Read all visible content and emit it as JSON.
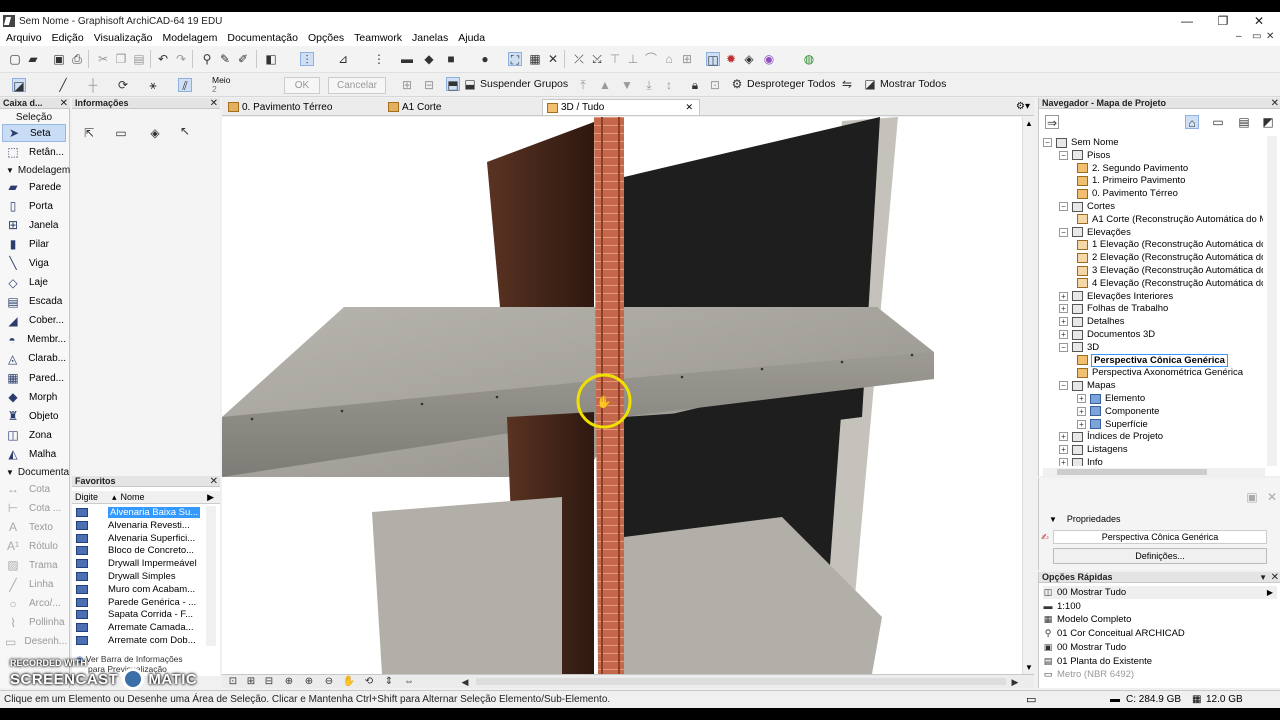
{
  "window": {
    "title": "Sem Nome - Graphisoft ArchiCAD-64 19 EDU",
    "min": "—",
    "max": "❐",
    "close": "✕"
  },
  "menu": [
    "Arquivo",
    "Edição",
    "Visualização",
    "Modelagem",
    "Documentação",
    "Opções",
    "Teamwork",
    "Janelas",
    "Ajuda"
  ],
  "toolbar2": {
    "meio_label": "Meio",
    "meio_value": "2",
    "ok": "OK",
    "cancel": "Cancelar",
    "suspend_groups": "Suspender Grupos",
    "unprotect_all": "Desproteger Todos",
    "show_all": "Mostrar Todos"
  },
  "toolbox": {
    "title": "Caixa d...",
    "groups": {
      "selection": "Seleção",
      "modeling": "Modelagem",
      "document": "Documenta"
    },
    "selection_tools": [
      {
        "label": "Seta",
        "icon": "arrow-icon"
      },
      {
        "label": "Retân...",
        "icon": "marquee-icon"
      }
    ],
    "modeling_tools": [
      {
        "label": "Parede",
        "icon": "wall-icon"
      },
      {
        "label": "Porta",
        "icon": "door-icon"
      },
      {
        "label": "Janela",
        "icon": "window-icon"
      },
      {
        "label": "Pilar",
        "icon": "column-icon"
      },
      {
        "label": "Viga",
        "icon": "beam-icon"
      },
      {
        "label": "Laje",
        "icon": "slab-icon"
      },
      {
        "label": "Escada",
        "icon": "stair-icon"
      },
      {
        "label": "Cober...",
        "icon": "roof-icon"
      },
      {
        "label": "Membr...",
        "icon": "membrane-icon"
      },
      {
        "label": "Clarab...",
        "icon": "skylight-icon"
      },
      {
        "label": "Pared...",
        "icon": "curtain-wall-icon"
      },
      {
        "label": "Morph",
        "icon": "morph-icon"
      },
      {
        "label": "Objeto",
        "icon": "object-icon"
      },
      {
        "label": "Zona",
        "icon": "zone-icon"
      },
      {
        "label": "Malha",
        "icon": "mesh-icon"
      }
    ],
    "document_tools": [
      {
        "label": "Cota",
        "icon": "dimension-icon"
      },
      {
        "label": "Cota ...",
        "icon": "level-dimension-icon"
      },
      {
        "label": "Texto",
        "icon": "text-icon"
      },
      {
        "label": "Rótulo",
        "icon": "label-icon"
      },
      {
        "label": "Trama",
        "icon": "fill-icon"
      },
      {
        "label": "Linha",
        "icon": "line-icon"
      },
      {
        "label": "Arco/...",
        "icon": "arc-icon"
      },
      {
        "label": "Pollinha",
        "icon": "polyline-icon"
      },
      {
        "label": "Desenh...",
        "icon": "drawing-icon"
      }
    ]
  },
  "info_panel": {
    "title": "Informações"
  },
  "favorites": {
    "title": "Favoritos",
    "col_digit": "Digite",
    "col_name": "Nome",
    "items": [
      "Alvenaria Baixa Su...",
      "Alvenaria Revesti...",
      "Alvenaria Superfici...",
      "Bloco de Concreto...",
      "Drywall Impermeável",
      "Drywall Simples",
      "Muro com Acabam...",
      "Parede Genérica - ...",
      "Sapata Corrida - F...",
      "Arremate Camada...",
      "Arremate com Dob..."
    ],
    "footer1": "Ver Barra de Informações",
    "footer2": "para Previsualização"
  },
  "tabs": [
    {
      "label": "0. Pavimento Térreo"
    },
    {
      "label": "A1 Corte"
    },
    {
      "label": "3D / Tudo"
    }
  ],
  "navigator": {
    "title": "Navegador - Mapa de Projeto",
    "tree": [
      {
        "label": "Sem Nome",
        "level": 0,
        "icon": "project"
      },
      {
        "label": "Pisos",
        "level": 1,
        "icon": "folder"
      },
      {
        "label": "2. Segundo Pavimento",
        "level": 2,
        "icon": "view"
      },
      {
        "label": "1. Primeiro Pavimento",
        "level": 2,
        "icon": "view"
      },
      {
        "label": "0. Pavimento Térreo",
        "level": 2,
        "icon": "view"
      },
      {
        "label": "Cortes",
        "level": 1,
        "icon": "folder"
      },
      {
        "label": "A1 Corte (Reconstrução Automática do M",
        "level": 2,
        "icon": "cut"
      },
      {
        "label": "Elevações",
        "level": 1,
        "icon": "folder"
      },
      {
        "label": "1 Elevação (Reconstrução Automática do",
        "level": 2,
        "icon": "cut"
      },
      {
        "label": "2 Elevação (Reconstrução Automática do",
        "level": 2,
        "icon": "cut"
      },
      {
        "label": "3 Elevação (Reconstrução Automática do",
        "level": 2,
        "icon": "cut"
      },
      {
        "label": "4 Elevação (Reconstrução Automática do",
        "level": 2,
        "icon": "cut"
      },
      {
        "label": "Elevações Interiores",
        "level": 1,
        "icon": "folder"
      },
      {
        "label": "Folhas de Trabalho",
        "level": 1,
        "icon": "folder"
      },
      {
        "label": "Detalhes",
        "level": 1,
        "icon": "folder"
      },
      {
        "label": "Documentos 3D",
        "level": 1,
        "icon": "folder"
      },
      {
        "label": "3D",
        "level": 1,
        "icon": "folder"
      },
      {
        "label": "Perspectiva Cônica Genérica",
        "level": 2,
        "icon": "view",
        "selected": true
      },
      {
        "label": "Perspectiva Axonométrica Genérica",
        "level": 2,
        "icon": "view"
      },
      {
        "label": "Mapas",
        "level": 1,
        "icon": "folder"
      },
      {
        "label": "Elemento",
        "level": 2,
        "icon": "map"
      },
      {
        "label": "Componente",
        "level": 2,
        "icon": "map"
      },
      {
        "label": "Superfície",
        "level": 2,
        "icon": "map"
      },
      {
        "label": "Índices de Projeto",
        "level": 1,
        "icon": "folder"
      },
      {
        "label": "Listagens",
        "level": 1,
        "icon": "folder"
      },
      {
        "label": "Info",
        "level": 1,
        "icon": "folder"
      }
    ]
  },
  "properties": {
    "title": "Propriedades",
    "value": "Perspectiva Cônica Genérica",
    "button": "Definições..."
  },
  "quick_options": {
    "title": "Opções Rápidas",
    "items": [
      {
        "icon": "layer-icon",
        "label": "00 Mostrar Tudo",
        "glyph": "◫"
      },
      {
        "icon": "scale-icon",
        "label": "1:100",
        "glyph": "▬"
      },
      {
        "icon": "model-icon",
        "label": "Modelo Completo",
        "glyph": "▦"
      },
      {
        "icon": "pen-icon",
        "label": "01 Cor Conceitual ARCHICAD",
        "glyph": "⚲"
      },
      {
        "icon": "mvo-icon",
        "label": "00 Mostrar Tudo",
        "glyph": "▣"
      },
      {
        "icon": "renovation-icon",
        "label": "01 Planta do Existente",
        "glyph": "▤"
      },
      {
        "icon": "dimension-icon",
        "label": "Metro (NBR 6492)",
        "glyph": "▭"
      }
    ]
  },
  "status": {
    "hint": "Clique em um Elemento ou Desenhe uma Área de Seleção. Clicar e Mantenha Ctrl+Shift para Alternar Seleção Elemento/Sub-Elemento.",
    "disk": "C: 284.9 GB",
    "memory": "12.0 GB"
  },
  "watermark": {
    "line1": "RECORDED WITH",
    "line2": "SCREENCAST",
    "line3": "MATIC"
  }
}
